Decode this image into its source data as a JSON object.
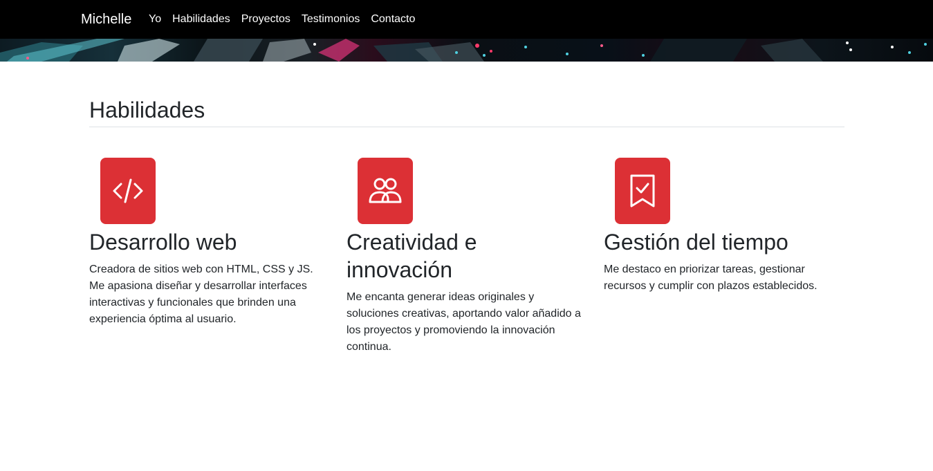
{
  "nav": {
    "brand": "Michelle",
    "links": [
      "Yo",
      "Habilidades",
      "Proyectos",
      "Testimonios",
      "Contacto"
    ]
  },
  "section": {
    "title": "Habilidades"
  },
  "features": [
    {
      "icon": "code-icon",
      "title": "Desarrollo web",
      "text": "Creadora de sitios web con HTML, CSS y JS. Me apasiona diseñar y desarrollar interfaces interactivas y funcionales que brinden una experiencia óptima al usuario."
    },
    {
      "icon": "people-icon",
      "title": "Creatividad e innovación",
      "text": "Me encanta generar ideas originales y soluciones creativas, aportando valor añadido a los proyectos y promoviendo la innovación continua."
    },
    {
      "icon": "bookmark-check-icon",
      "title": "Gestión del tiempo",
      "text": "Me destaco en priorizar tareas, gestionar recursos y cumplir con plazos establecidos."
    }
  ],
  "colors": {
    "navbar": "#000000",
    "accent": "#dc3035"
  }
}
